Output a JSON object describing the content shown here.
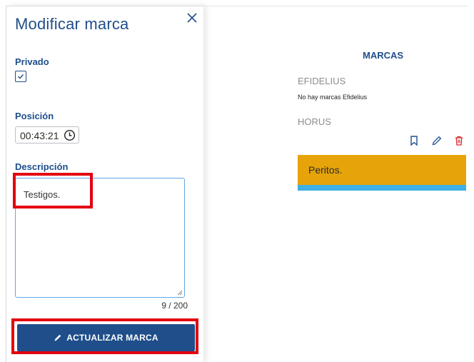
{
  "panel": {
    "title": "Modificar marca",
    "privado_label": "Privado",
    "privado_checked": true,
    "posicion_label": "Posición",
    "posicion_value": "00:43:21",
    "descripcion_label": "Descripción",
    "descripcion_value": "Testigos.",
    "char_counter": "9 / 200",
    "update_button_label": "ACTUALIZAR MARCA"
  },
  "marcas": {
    "title": "MARCAS",
    "sections": [
      {
        "name": "EFIDELIUS",
        "empty_text": "No hay marcas Efidelius"
      },
      {
        "name": "HORUS"
      }
    ],
    "items": [
      {
        "text": "Peritos."
      }
    ],
    "actions": [
      "bookmark-icon",
      "pencil-icon",
      "trash-icon"
    ]
  },
  "colors": {
    "primary": "#1f4e8a",
    "mark_card": "#e6a40a",
    "mark_bar": "#3fb0e6",
    "delete": "#d9262e",
    "highlight": "#e3000f"
  }
}
